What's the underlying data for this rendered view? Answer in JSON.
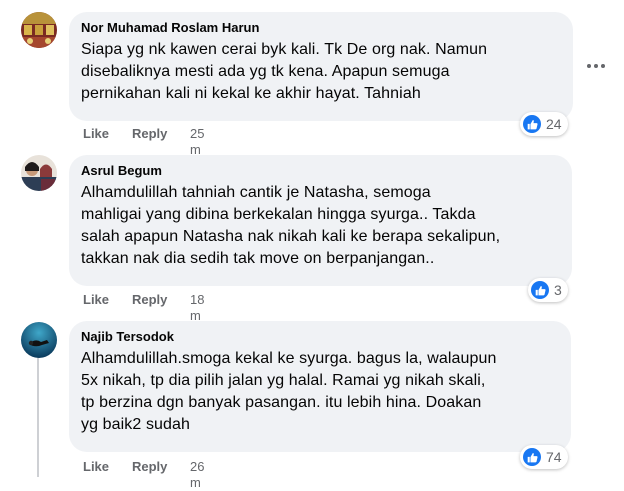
{
  "comments": [
    {
      "author": "Nor Muhamad Roslam Harun",
      "lines": [
        "Siapa yg nk kawen cerai byk kali. Tk De org nak. Namun",
        "disebaliknya mesti ada yg tk kena. Apapun semuga",
        "pernikahan kali ni kekal ke akhir hayat. Tahniah"
      ],
      "like_label": "Like",
      "reply_label": "Reply",
      "time": "25 m",
      "reaction_icon": "like-icon",
      "reaction_count": "24"
    },
    {
      "author": "Asrul Begum",
      "lines": [
        "Alhamdulillah tahniah cantik je Natasha, semoga",
        "mahligai yang dibina berkekalan hingga syurga.. Takda",
        "salah apapun Natasha nak nikah kali ke berapa sekalipun,",
        "takkan nak dia sedih tak move on berpanjangan.."
      ],
      "like_label": "Like",
      "reply_label": "Reply",
      "time": "18 m",
      "reaction_icon": "like-icon",
      "reaction_count": "3"
    },
    {
      "author": "Najib Tersodok",
      "lines": [
        "Alhamdulillah.smoga kekal ke syurga. bagus la, walaupun",
        "5x nikah, tp dia pilih jalan yg halal. Ramai yg nikah skali,",
        "tp berzina dgn banyak pasangan. itu lebih hina. Doakan",
        "yg baik2 sudah"
      ],
      "like_label": "Like",
      "reply_label": "Reply",
      "time": "26 m",
      "reaction_icon": "like-icon",
      "reaction_count": "74"
    }
  ],
  "colors": {
    "bubble": "#f0f2f5",
    "meta_text": "#65676b",
    "like_blue": "#1877f2"
  }
}
